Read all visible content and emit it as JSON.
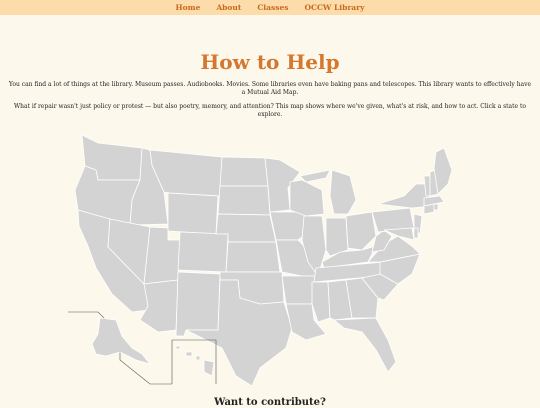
{
  "nav": {
    "items": [
      "Home",
      "About",
      "Classes",
      "OCCW Library"
    ]
  },
  "page": {
    "title": "How to Help",
    "intro": "You can find a lot of things at the library. Museum passes. Audiobooks. Movies. Some libraries even have baking pans and telescopes. This library wants to effectively have a Mutual Aid Map.",
    "prompt": "What if repair wasn't just policy or protest — but also poetry, memory, and attention? This map shows where we've given, what's at risk, and how to act. Click a state to explore.",
    "contribute_heading": "Want to contribute?"
  },
  "map": {
    "state_color": "#d3d3d3",
    "border_color": "#ffffff"
  }
}
